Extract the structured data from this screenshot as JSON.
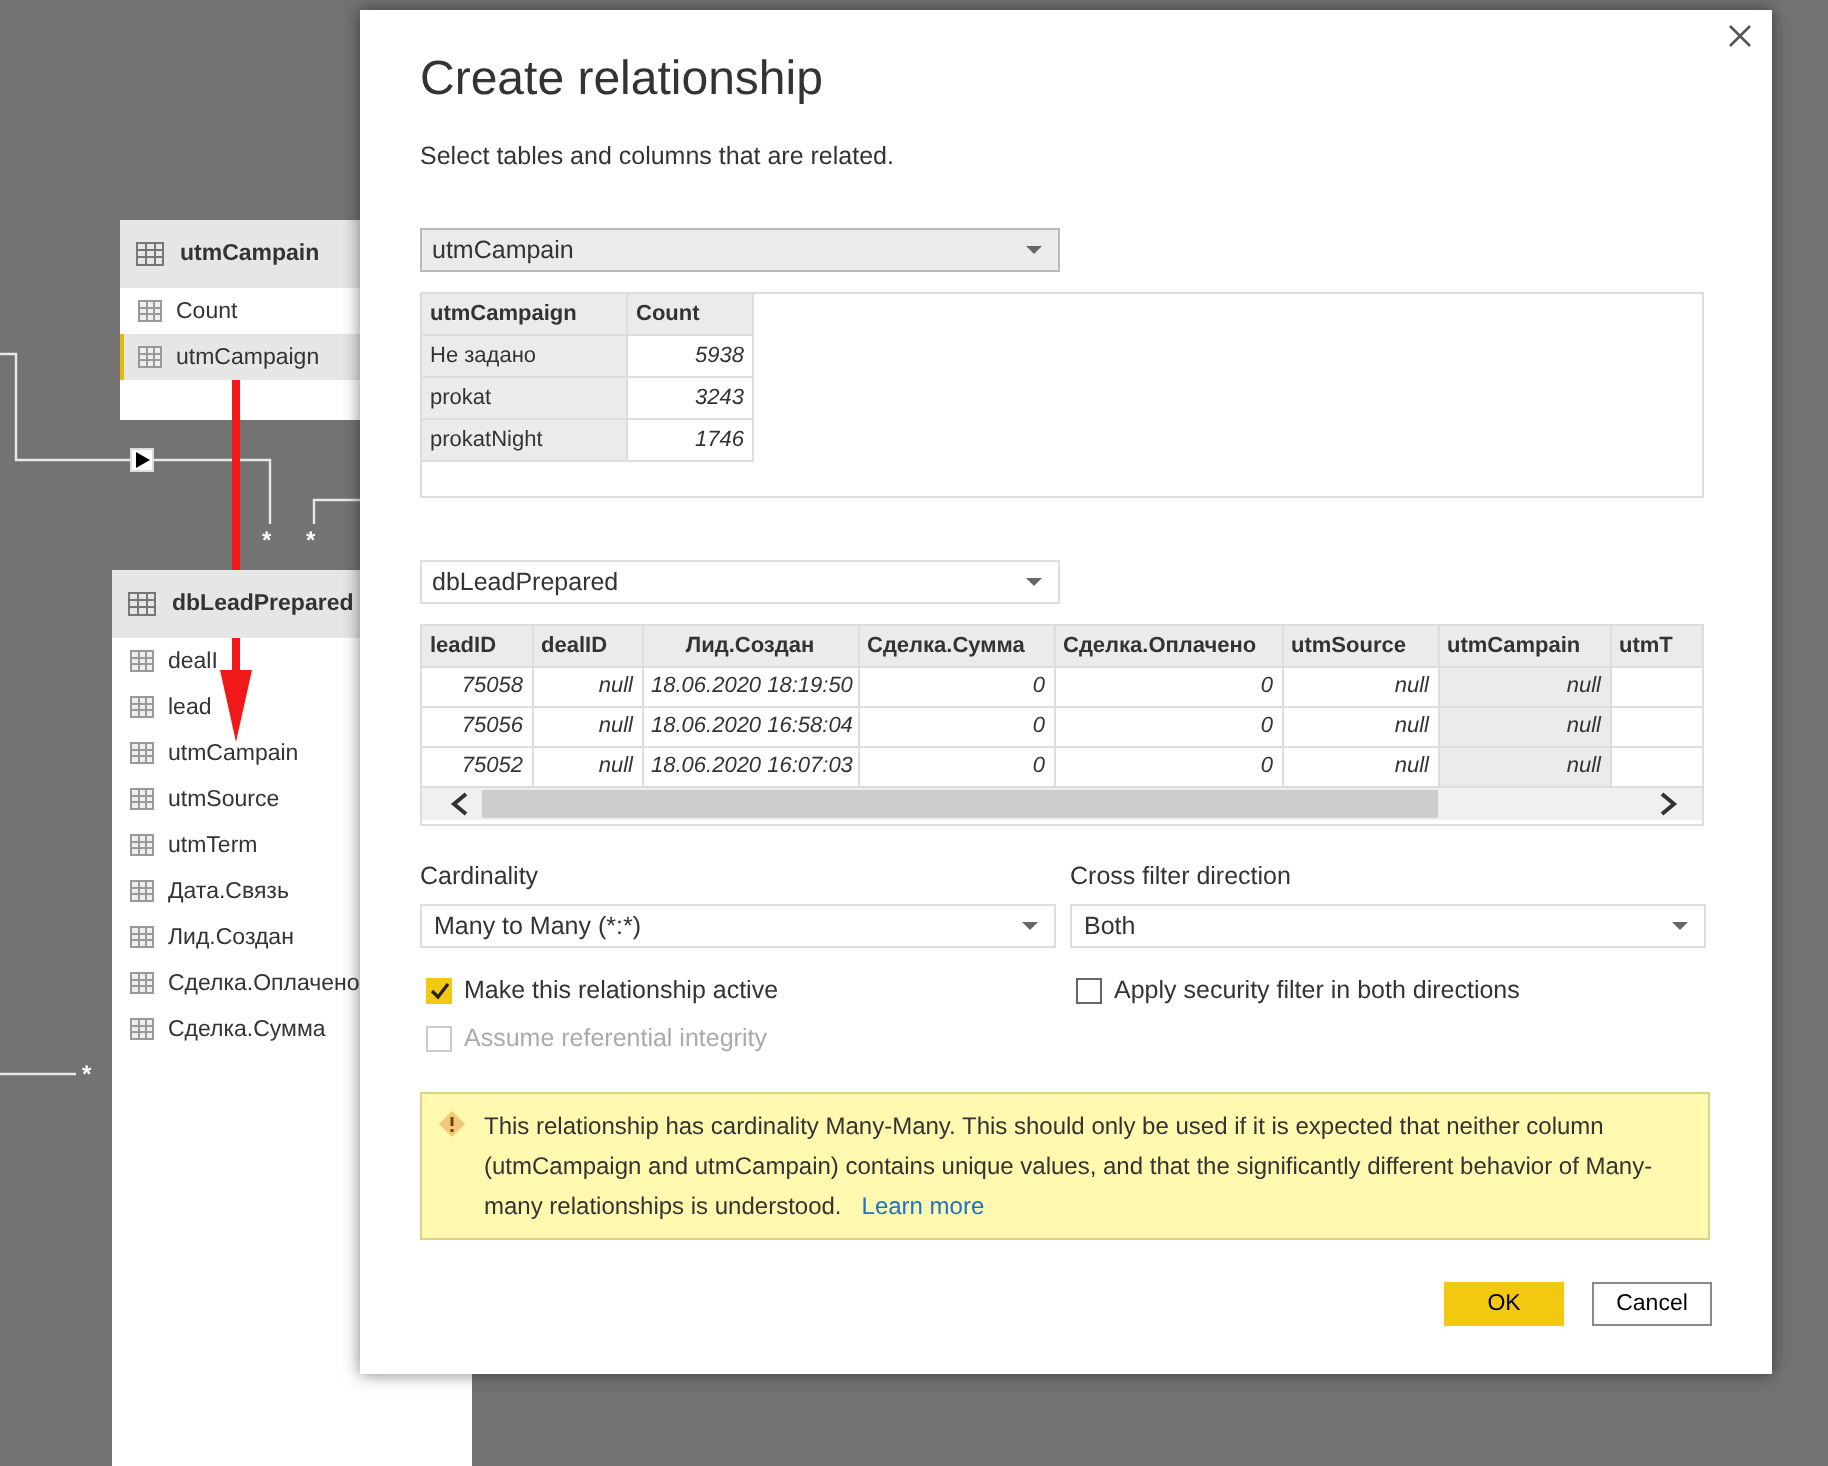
{
  "canvas": {
    "tables": [
      {
        "name": "utmCampain",
        "fields": [
          {
            "name": "Count",
            "selected": false
          },
          {
            "name": "utmCampaign",
            "selected": true
          }
        ]
      },
      {
        "name": "dbLeadPrepared",
        "fields": [
          {
            "name": "dealI",
            "selected": false
          },
          {
            "name": "lead",
            "selected": false
          },
          {
            "name": "utmCampain",
            "selected": false
          },
          {
            "name": "utmSource",
            "selected": false
          },
          {
            "name": "utmTerm",
            "selected": false
          },
          {
            "name": "Дата.Связь",
            "selected": false
          },
          {
            "name": "Лид.Создан",
            "selected": false
          },
          {
            "name": "Сделка.Оплачено",
            "selected": false
          },
          {
            "name": "Сделка.Сумма",
            "selected": false
          }
        ]
      }
    ],
    "cardinality_marks": [
      "*",
      "*",
      "*"
    ]
  },
  "dialog": {
    "title": "Create relationship",
    "subtitle": "Select tables and columns that are related.",
    "table_1": {
      "dropdown": "utmCampain",
      "columns": [
        {
          "label": "utmCampaign",
          "selected": true
        },
        {
          "label": "Count",
          "selected": false
        }
      ],
      "rows": [
        [
          "Не задано",
          "5938"
        ],
        [
          "prokat",
          "3243"
        ],
        [
          "prokatNight",
          "1746"
        ]
      ]
    },
    "table_2": {
      "dropdown": "dbLeadPrepared",
      "columns": [
        {
          "label": "leadID",
          "selected": false
        },
        {
          "label": "dealID",
          "selected": false
        },
        {
          "label": "Лид.Создан",
          "selected": false
        },
        {
          "label": "Сделка.Сумма",
          "selected": false
        },
        {
          "label": "Сделка.Оплачено",
          "selected": false
        },
        {
          "label": "utmSource",
          "selected": false
        },
        {
          "label": "utmCampain",
          "selected": true
        },
        {
          "label": "utmT",
          "selected": false
        }
      ],
      "rows": [
        [
          "75058",
          "null",
          "18.06.2020 18:19:50",
          "0",
          "0",
          "null",
          "null"
        ],
        [
          "75056",
          "null",
          "18.06.2020 16:58:04",
          "0",
          "0",
          "null",
          "null"
        ],
        [
          "75052",
          "null",
          "18.06.2020 16:07:03",
          "0",
          "0",
          "null",
          "null"
        ]
      ]
    },
    "cardinality": {
      "label": "Cardinality",
      "value": "Many to Many (*:*)"
    },
    "cross_filter": {
      "label": "Cross filter direction",
      "value": "Both"
    },
    "options": [
      {
        "label": "Make this relationship active",
        "checked": true,
        "disabled": false
      },
      {
        "label": "Apply security filter in both directions",
        "checked": false,
        "disabled": false
      },
      {
        "label": "Assume referential integrity",
        "checked": false,
        "disabled": true
      }
    ],
    "warning": {
      "text": "This relationship has cardinality Many-Many. This should only be used if it is expected that neither column (utmCampaign and utmCampain) contains unique values, and that the significantly different behavior of Many-many relationships is understood.",
      "link": "Learn more"
    },
    "buttons": [
      {
        "label": "OK",
        "kind": "primary"
      },
      {
        "label": "Cancel",
        "kind": "secondary"
      }
    ]
  }
}
